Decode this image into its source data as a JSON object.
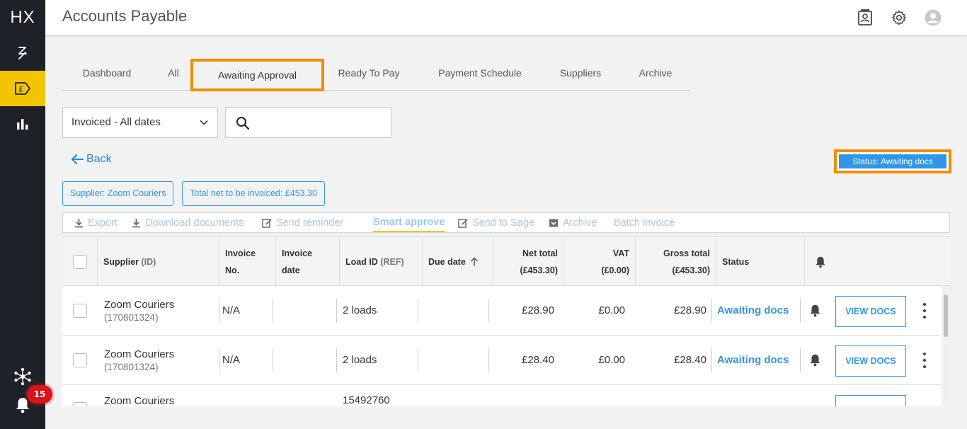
{
  "app": {
    "logo": "HX",
    "title": "Accounts Payable",
    "notification_count": "15"
  },
  "sidebar": {
    "items": [
      {
        "name": "route-icon"
      },
      {
        "name": "pound-tag-icon",
        "active": true
      },
      {
        "name": "bar-chart-icon"
      }
    ]
  },
  "tabs": [
    "Dashboard",
    "All",
    "Awaiting Approval",
    "Ready To Pay",
    "Payment Schedule",
    "Suppliers",
    "Archive"
  ],
  "active_tab": "Awaiting Approval",
  "filters": {
    "date_filter": "Invoiced - All dates",
    "search_value": ""
  },
  "back_label": "Back",
  "status_filter": "Status: Awaiting docs",
  "chips": {
    "supplier": "Supplier: Zoom Couriers",
    "total": "Total net to be invoiced: £453.30"
  },
  "toolbar": {
    "export": "Export",
    "download": "Download documents",
    "send_reminder": "Send reminder",
    "smart_approve": "Smart approve",
    "send_to_sage": "Send to Sage",
    "archive": "Archive",
    "batch_invoice": "Batch invoice"
  },
  "table": {
    "headers": {
      "supplier": "Supplier",
      "supplier_id": "(ID)",
      "invoice_no_1": "Invoice",
      "invoice_no_2": "No.",
      "invoice_date_1": "Invoice",
      "invoice_date_2": "date",
      "load_id": "Load ID",
      "load_ref": "(REF)",
      "due_date": "Due date",
      "net_total_1": "Net total",
      "net_total_2": "(£453.30)",
      "vat_1": "VAT",
      "vat_2": "(£0.00)",
      "gross_total_1": "Gross total",
      "gross_total_2": "(£453.30)",
      "status": "Status"
    },
    "rows": [
      {
        "supplier": "Zoom Couriers",
        "supplier_id": "(170801324)",
        "invoice_no": "N/A",
        "invoice_date": "",
        "load_id": "2 loads",
        "due_date": "",
        "net_total": "£28.90",
        "vat": "£0.00",
        "gross_total": "£28.90",
        "status": "Awaiting docs",
        "action": "VIEW DOCS"
      },
      {
        "supplier": "Zoom Couriers",
        "supplier_id": "(170801324)",
        "invoice_no": "N/A",
        "invoice_date": "",
        "load_id": "2 loads",
        "due_date": "",
        "net_total": "£28.40",
        "vat": "£0.00",
        "gross_total": "£28.40",
        "status": "Awaiting docs",
        "action": "VIEW DOCS"
      },
      {
        "supplier": "Zoom Couriers",
        "supplier_id": "",
        "invoice_no": "",
        "invoice_date": "",
        "load_id": "15492760",
        "due_date": "",
        "net_total": "",
        "vat": "",
        "gross_total": "",
        "status": "",
        "action": ""
      }
    ]
  },
  "colors": {
    "accent_yellow": "#f4c400",
    "highlight_orange": "#f28c00",
    "link_blue": "#2f96e8",
    "sidebar_bg": "#1f2128",
    "badge_red": "#d9131a"
  }
}
